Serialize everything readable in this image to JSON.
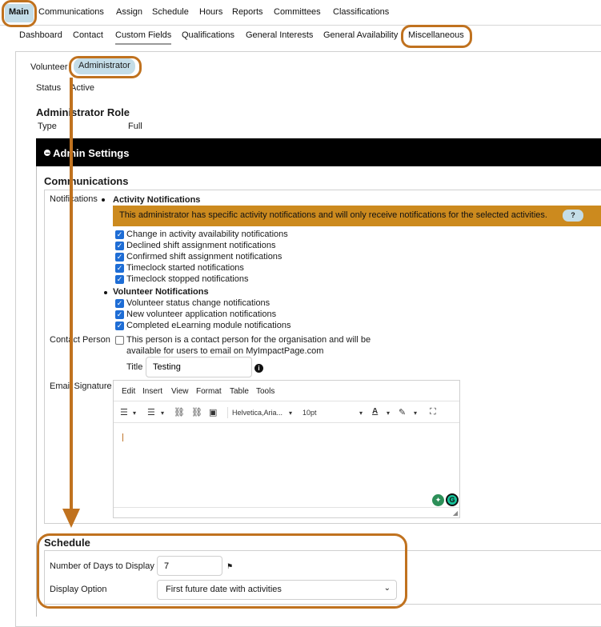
{
  "nav_main": {
    "items": [
      "Main",
      "Communications",
      "Assign",
      "Schedule",
      "Hours",
      "Reports",
      "Committees",
      "Classifications"
    ]
  },
  "nav_sub": {
    "items": [
      "Dashboard",
      "Contact",
      "Custom Fields",
      "Qualifications",
      "General Interests",
      "General Availability",
      "Miscellaneous"
    ]
  },
  "role_tabs": [
    "Volunteer",
    "Administrator"
  ],
  "status": {
    "label": "Status",
    "value": "Active"
  },
  "admin_role": {
    "heading": "Administrator Role",
    "type_label": "Type",
    "type_value": "Full"
  },
  "admin_settings": {
    "title": "Admin Settings",
    "toggle_icon": "minus-circle-icon"
  },
  "communications": {
    "heading": "Communications",
    "notifications_label": "Notifications",
    "activity_heading": "Activity Notifications",
    "notice": "This administrator has specific activity notifications and will only receive notifications for the selected activities.",
    "help_label": "?",
    "activity_items": [
      "Change in activity availability notifications",
      "Declined shift assignment notifications",
      "Confirmed shift assignment notifications",
      "Timeclock started notifications",
      "Timeclock stopped notifications"
    ],
    "volunteer_heading": "Volunteer Notifications",
    "volunteer_items": [
      "Volunteer status change notifications",
      "New volunteer application notifications",
      "Completed eLearning module notifications"
    ],
    "contact_person_label": "Contact Person",
    "contact_person_text_line1": "This person is a contact person for the organisation and will be",
    "contact_person_text_line2": "available for users to email on MyImpactPage.com",
    "title_label": "Title",
    "title_value": "Testing",
    "email_signature_label": "Email Signature"
  },
  "editor": {
    "menu": [
      "Edit",
      "Insert",
      "View",
      "Format",
      "Table",
      "Tools"
    ],
    "font_family": "Helvetica,Aria...",
    "font_size": "10pt"
  },
  "schedule": {
    "heading": "Schedule",
    "days_label": "Number of Days to Display",
    "days_value": "7",
    "display_label": "Display Option",
    "display_value": "First future date with activities"
  },
  "colors": {
    "accent": "#c0721f",
    "pill": "#c4dde8",
    "notice": "#cc8a1e",
    "checkbox": "#1e6dd5"
  }
}
